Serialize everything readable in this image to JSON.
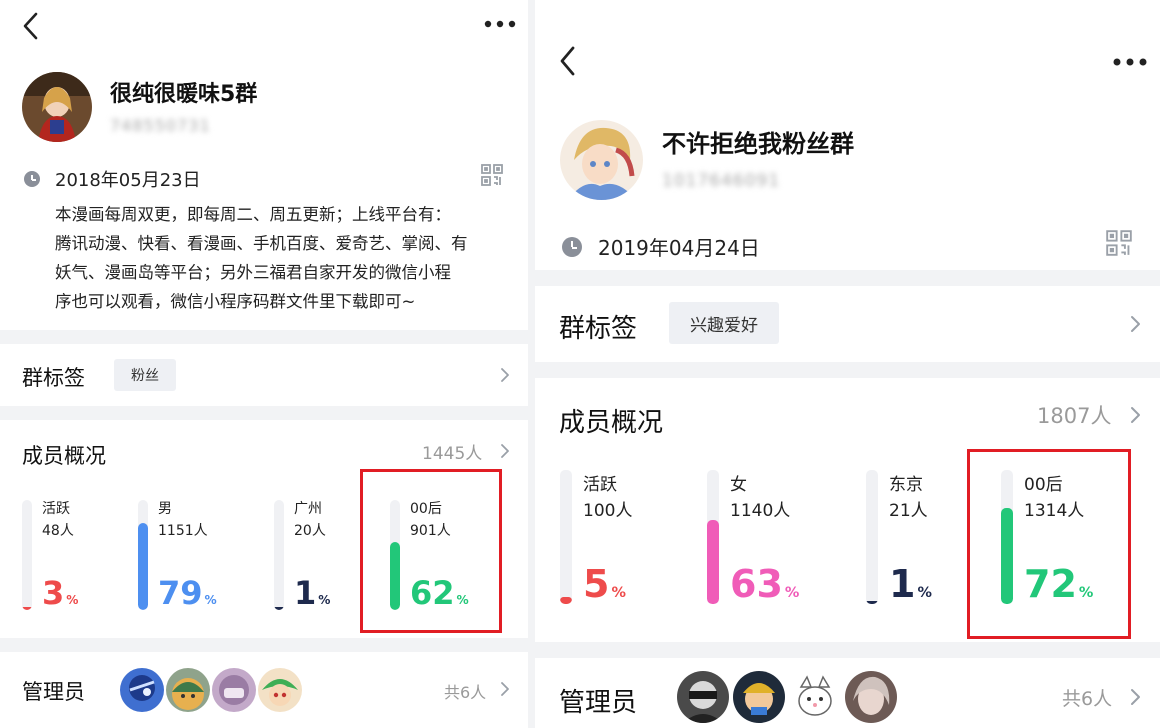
{
  "colors": {
    "red": "#ee4b4b",
    "blue": "#4d8ff0",
    "navy": "#1e2a4d",
    "green": "#22c779",
    "pink": "#f05cb8",
    "highlight": "#e11d24"
  },
  "left": {
    "back_icon": "back-arrow-icon",
    "more_icon": "more-dots-icon",
    "group_name": "很纯很暖味5群",
    "group_id": "748550731",
    "date": "2018年05月23日",
    "description_lines": [
      "本漫画每周双更，即每周二、周五更新；上线平台有：",
      "腾讯动漫、快看、看漫画、手机百度、爱奇艺、掌阅、有",
      "妖气、漫画岛等平台；另外三福君自家开发的微信小程",
      "序也可以观看，微信小程序码群文件里下载即可~"
    ],
    "tags_title": "群标签",
    "tag": "粉丝",
    "members_title": "成员概况",
    "members_count": "1445人",
    "stats": [
      {
        "label": "活跃",
        "count": "48人",
        "percent": "3",
        "unit": "%",
        "fill": 0.03,
        "color": "#ee4b4b"
      },
      {
        "label": "男",
        "count": "1151人",
        "percent": "79",
        "unit": "%",
        "fill": 0.79,
        "color": "#4d8ff0"
      },
      {
        "label": "广州",
        "count": "20人",
        "percent": "1",
        "unit": "%",
        "fill": 0.01,
        "color": "#1e2a4d"
      },
      {
        "label": "00后",
        "count": "901人",
        "percent": "62",
        "unit": "%",
        "fill": 0.62,
        "color": "#22c779"
      }
    ],
    "admins_title": "管理员",
    "admins_total": "共6人"
  },
  "right": {
    "back_icon": "back-arrow-icon",
    "more_icon": "more-dots-icon",
    "group_name": "不许拒绝我粉丝群",
    "group_id": "1017646091",
    "date": "2019年04月24日",
    "tags_title": "群标签",
    "tag": "兴趣爱好",
    "members_title": "成员概况",
    "members_count": "1807人",
    "stats": [
      {
        "label": "活跃",
        "count": "100人",
        "percent": "5",
        "unit": "%",
        "fill": 0.05,
        "color": "#ee4b4b"
      },
      {
        "label": "女",
        "count": "1140人",
        "percent": "63",
        "unit": "%",
        "fill": 0.63,
        "color": "#f05cb8"
      },
      {
        "label": "东京",
        "count": "21人",
        "percent": "1",
        "unit": "%",
        "fill": 0.01,
        "color": "#1e2a4d"
      },
      {
        "label": "00后",
        "count": "1314人",
        "percent": "72",
        "unit": "%",
        "fill": 0.72,
        "color": "#22c779"
      }
    ],
    "admins_title": "管理员",
    "admins_total": "共6人"
  }
}
